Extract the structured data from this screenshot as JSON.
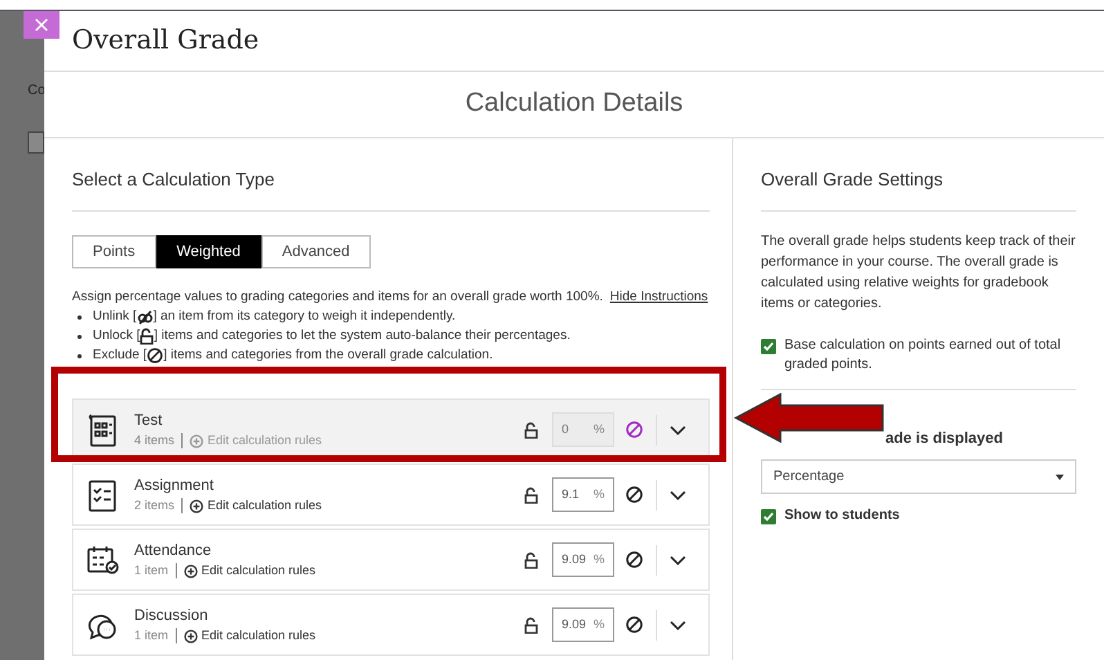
{
  "background": {
    "nav_text": "Co"
  },
  "dialog": {
    "title": "Overall Grade",
    "section_title": "Calculation Details"
  },
  "calculation": {
    "heading": "Select a Calculation Type",
    "tabs": [
      {
        "label": "Points",
        "selected": false
      },
      {
        "label": "Weighted",
        "selected": true
      },
      {
        "label": "Advanced",
        "selected": false
      }
    ],
    "instructions": {
      "text": "Assign percentage values to grading categories and items for an overall grade worth 100%.",
      "link": "Hide Instructions",
      "bullets": [
        {
          "kind": "unlink",
          "before": "Unlink [",
          "after": "] an item from its category to weigh it independently."
        },
        {
          "kind": "unlock",
          "before": "Unlock [",
          "after": "] items and categories to let the system auto-balance their percentages."
        },
        {
          "kind": "exclude",
          "before": "Exclude [",
          "after": "] items and categories from the overall grade calculation."
        }
      ]
    },
    "categories": [
      {
        "kind": "test",
        "name": "Test",
        "count": "4 items",
        "edit": "Edit calculation rules",
        "value": "0",
        "unit": "%",
        "excluded": true
      },
      {
        "kind": "assignment",
        "name": "Assignment",
        "count": "2 items",
        "edit": "Edit calculation rules",
        "value": "9.1",
        "unit": "%",
        "excluded": false
      },
      {
        "kind": "attendance",
        "name": "Attendance",
        "count": "1 item",
        "edit": "Edit calculation rules",
        "value": "9.09",
        "unit": "%",
        "excluded": false
      },
      {
        "kind": "discussion",
        "name": "Discussion",
        "count": "1 item",
        "edit": "Edit calculation rules",
        "value": "9.09",
        "unit": "%",
        "excluded": false
      }
    ]
  },
  "settings": {
    "heading": "Overall Grade Settings",
    "description": "The overall grade helps students keep track of their performance in your course. The overall grade is calculated using relative weights for gradebook items or categories.",
    "base_calc": {
      "label": "Base calculation on points earned out of total graded points.",
      "checked": true
    },
    "display_label": "ade is displayed",
    "display_value": "Percentage",
    "show_students": {
      "label": "Show to students",
      "checked": true
    }
  }
}
